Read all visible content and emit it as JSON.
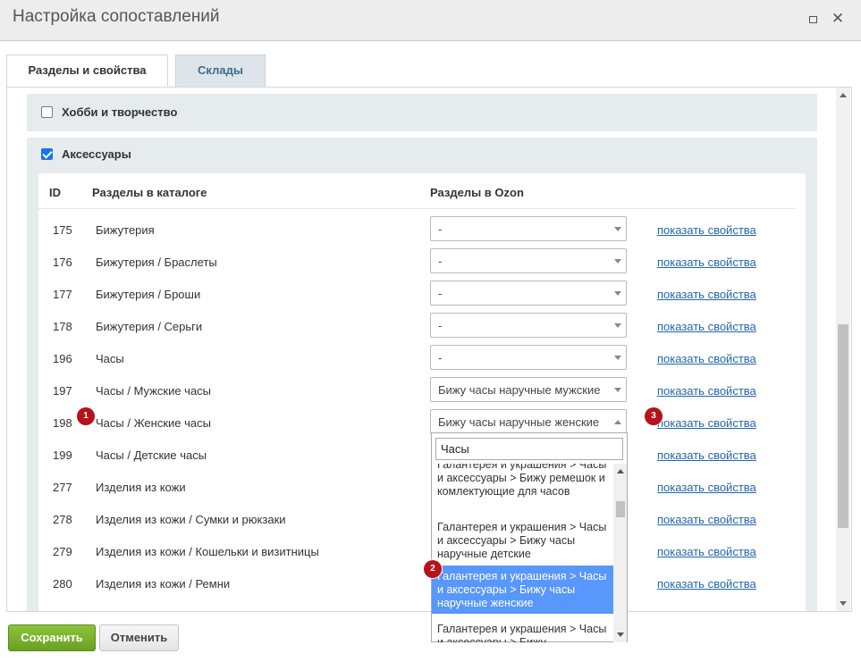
{
  "window": {
    "title": "Настройка сопоставлений",
    "maximize_icon": "maximize-icon",
    "close_icon": "close-icon",
    "close_glyph": "✕"
  },
  "tabs": [
    {
      "label": "Разделы и свойства",
      "active": true
    },
    {
      "label": "Склады",
      "active": false
    }
  ],
  "sections": {
    "hobby": {
      "label": "Хобби и творчество",
      "checked": false
    },
    "accessories": {
      "label": "Аксессуары",
      "checked": true
    }
  },
  "table": {
    "headers": {
      "id": "ID",
      "catalog": "Разделы в каталоге",
      "ozon": "Разделы в Ozon"
    },
    "rows": [
      {
        "id": "175",
        "name": "Бижутерия",
        "ozon": "-",
        "link": "показать свойства"
      },
      {
        "id": "176",
        "name": "Бижутерия / Браслеты",
        "ozon": "-",
        "link": "показать свойства"
      },
      {
        "id": "177",
        "name": "Бижутерия / Броши",
        "ozon": "-",
        "link": "показать свойства"
      },
      {
        "id": "178",
        "name": "Бижутерия / Серьги",
        "ozon": "-",
        "link": "показать свойства"
      },
      {
        "id": "196",
        "name": "Часы",
        "ozon": "-",
        "link": "показать свойства"
      },
      {
        "id": "197",
        "name": "Часы / Мужские часы",
        "ozon": "Бижу часы наручные мужские",
        "link": "показать свойства"
      },
      {
        "id": "198",
        "name": "Часы / Женские часы",
        "ozon": "Бижу часы наручные женские",
        "link": "показать свойства"
      },
      {
        "id": "199",
        "name": "Часы / Детские часы",
        "ozon": "",
        "link": "показать свойства"
      },
      {
        "id": "277",
        "name": "Изделия из кожи",
        "ozon": "",
        "link": "показать свойства"
      },
      {
        "id": "278",
        "name": "Изделия из кожи / Сумки и рюкзаки",
        "ozon": "",
        "link": "показать свойства"
      },
      {
        "id": "279",
        "name": "Изделия из кожи / Кошельки и визитницы",
        "ozon": "",
        "link": "показать свойства"
      },
      {
        "id": "280",
        "name": "Изделия из кожи / Ремни",
        "ozon": "",
        "link": "показать свойства"
      }
    ]
  },
  "dropdown": {
    "search_value": "Часы",
    "options": [
      "Галантерея и украшения > Часы и аксессуары > Бижу ремешок и комлектующие для часов",
      "Галантерея и украшения > Часы и аксессуары > Бижу часы наручные детские",
      "Галантерея и украшения > Часы и аксессуары > Бижу часы наручные женские",
      "Галантерея и украшения > Часы и аксессуары > Бижу"
    ],
    "highlighted_index": 2
  },
  "badges": [
    "1",
    "2",
    "3"
  ],
  "buttons": {
    "save": "Сохранить",
    "cancel": "Отменить"
  },
  "colors": {
    "accent": "#5897fb",
    "save": "#7ab02c",
    "badge": "#b5121b",
    "link": "#2067b0"
  }
}
